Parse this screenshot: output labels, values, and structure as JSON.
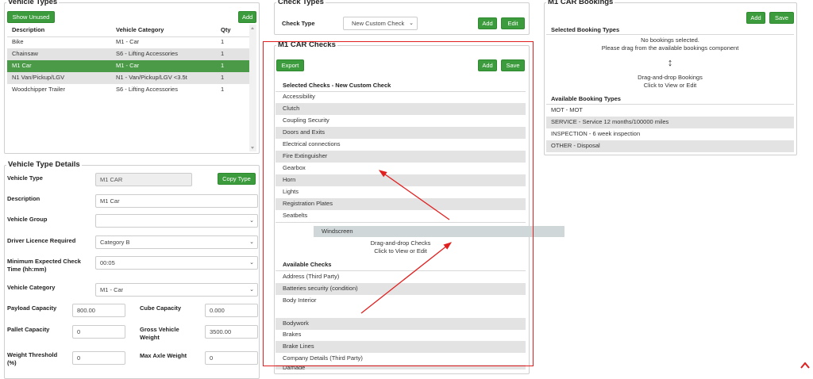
{
  "vehicle_types": {
    "legend": "Vehicle Types",
    "show_unused_label": "Show Unused",
    "add_label": "Add",
    "columns": [
      "Description",
      "Vehicle Category",
      "Qty"
    ],
    "rows": [
      {
        "description": "Bike",
        "category": "M1 - Car",
        "qty": "1"
      },
      {
        "description": "Chainsaw",
        "category": "S6 - Lifting Accessories",
        "qty": "1"
      },
      {
        "description": "M1 Car",
        "category": "M1 - Car",
        "qty": "1"
      },
      {
        "description": "N1 Van/Pickup/LGV",
        "category": "N1 - Van/Pickup/LGV <3.5t",
        "qty": "1"
      },
      {
        "description": "Woodchipper Trailer",
        "category": "S6 - Lifting Accessories",
        "qty": "1"
      }
    ],
    "selected_row": "M1 Car"
  },
  "vehicle_type_details": {
    "legend": "Vehicle Type Details",
    "vehicle_type_label": "Vehicle Type",
    "vehicle_type_value": "M1 CAR",
    "copy_type_label": "Copy Type",
    "description_label": "Description",
    "description_value": "M1 Car",
    "vehicle_group_label": "Vehicle Group",
    "vehicle_group_value": "",
    "licence_label": "Driver Licence Required",
    "licence_value": "Category B",
    "min_check_label": "Minimum Expected Check Time (hh:mm)",
    "min_check_value": "00:05",
    "vehicle_category_label": "Vehicle Category",
    "vehicle_category_value": "M1 - Car",
    "payload_label": "Payload Capacity",
    "payload_value": "800.00",
    "cube_label": "Cube Capacity",
    "cube_value": "0.000",
    "pallet_label": "Pallet Capacity",
    "pallet_value": "0",
    "gross_label": "Gross Vehicle Weight",
    "gross_value": "3500.00",
    "weight_threshold_label": "Weight Threshold (%)",
    "weight_threshold_value": "0",
    "max_axle_label": "Max Axle Weight",
    "max_axle_value": "0"
  },
  "check_types": {
    "legend": "Check Types",
    "check_type_label": "Check Type",
    "check_type_value": "New Custom Check",
    "add_label": "Add",
    "edit_label": "Edit"
  },
  "car_checks": {
    "legend": "M1 CAR Checks",
    "export_label": "Export",
    "add_label": "Add",
    "save_label": "Save",
    "selected_header": "Selected Checks - New Custom Check",
    "selected": [
      "Accessibility",
      "Clutch",
      "Coupling Security",
      "Doors and Exits",
      "Electrical connections",
      "Fire Extinguisher",
      "Gearbox",
      "Horn",
      "Lights",
      "Registration Plates",
      "Seatbelts"
    ],
    "dragging_item": "Windscreen",
    "drop_hint_line1": "Drag-and-drop Checks",
    "drop_hint_line2": "Click to View or Edit",
    "available_header": "Available Checks",
    "available": [
      "Address (Third Party)",
      "Batteries security (condition)",
      "Body Interior",
      "",
      "Bodywork",
      "Brakes",
      "Brake Lines",
      "Company Details (Third Party)",
      "Damage"
    ]
  },
  "bookings": {
    "legend": "M1 CAR Bookings",
    "add_label": "Add",
    "save_label": "Save",
    "selected_header": "Selected Booking Types",
    "empty_line1": "No bookings selected.",
    "empty_line2": "Please drag from the available bookings component",
    "drag_hint_line1": "Drag-and-drop Bookings",
    "drag_hint_line2": "Click to View or Edit",
    "available_header": "Available Booking Types",
    "available": [
      "MOT - MOT",
      "SERVICE - Service 12 months/100000 miles",
      "INSPECTION - 6 week inspection",
      "OTHER - Disposal"
    ]
  },
  "colors": {
    "accent_green": "#3c9b3c",
    "annotation_red": "#e02020",
    "row_grey": "#e3e3e3"
  }
}
